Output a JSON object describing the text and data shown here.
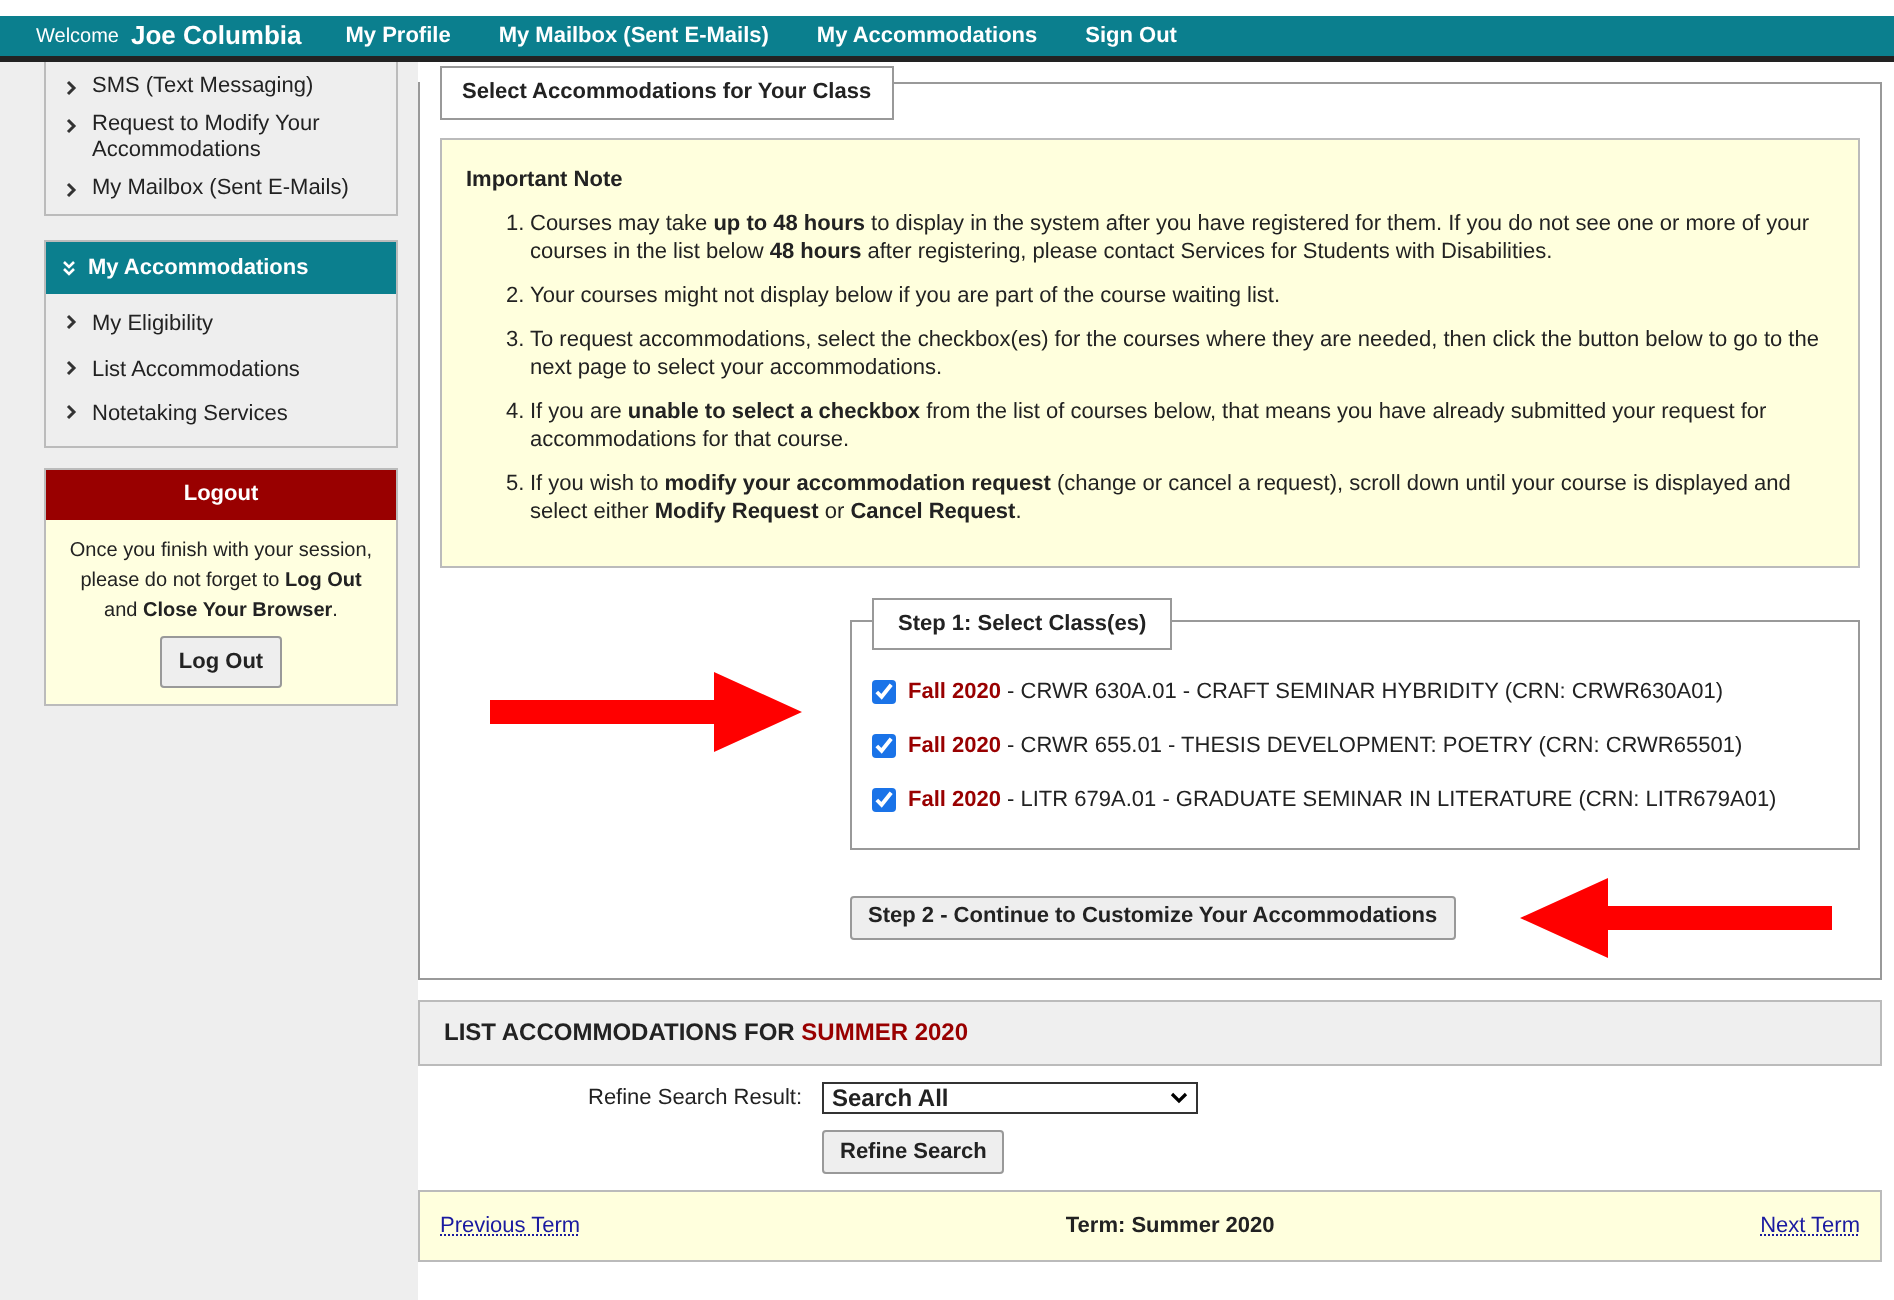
{
  "top_bar": {
    "welcome": "Welcome",
    "user": "Joe Columbia",
    "links": [
      "My Profile",
      "My Mailbox (Sent E-Mails)",
      "My Accommodations",
      "Sign Out"
    ]
  },
  "sidebar": {
    "top_items": [
      "SMS (Text Messaging)",
      "Request to Modify Your Accommodations",
      "My Mailbox (Sent E-Mails)"
    ],
    "section": {
      "title": "My Accommodations",
      "expanded": true,
      "items": [
        "My Eligibility",
        "List Accommodations",
        "Notetaking Services"
      ]
    },
    "logout": {
      "title": "Logout",
      "message": "Once you finish with your session, please do not forget to **Log Out** and **Close Your Browser**.",
      "button": "Log Out"
    }
  },
  "main": {
    "legend": "Select Accommodations for Your Class",
    "note_title": "Important Note",
    "notes": [
      {
        "number": "1.",
        "text": "Courses may take **up to 48 hours** to display in the system after you have registered for them. If you do not see one or more of your courses in the list below **48 hours** after registering, please contact Services for Students with Disabilities."
      },
      {
        "number": "2.",
        "text": "Your courses might not display below if you are part of the course waiting list."
      },
      {
        "number": "3.",
        "text": "To request accommodations, select the checkbox(es) for the courses where they are needed, then click the button below to go to the next page to select your accommodations."
      },
      {
        "number": "4.",
        "text": "If you are **unable to select a checkbox** from the list of courses below, that means you have already submitted your request for accommodations for that course."
      },
      {
        "number": "5.",
        "text": "If you wish to **modify your accommodation request** (change or cancel a request), scroll down until your course is displayed and select either **Modify Request** or **Cancel Request**."
      }
    ],
    "step1_legend": "Step 1: Select Class(es)",
    "courses": [
      {
        "term": "Fall 2020",
        "detail": " - CRWR 630A.01 - CRAFT SEMINAR HYBRIDITY (CRN: CRWR630A01)",
        "checked": true
      },
      {
        "term": "Fall 2020",
        "detail": " - CRWR 655.01 - THESIS DEVELOPMENT: POETRY (CRN: CRWR65501)",
        "checked": true
      },
      {
        "term": "Fall 2020",
        "detail": " - LITR 679A.01 - GRADUATE SEMINAR IN LITERATURE (CRN: LITR679A01)",
        "checked": true
      }
    ],
    "step2_button": "Step 2 - Continue to Customize Your Accommodations",
    "annotations": [
      {
        "kind": "right_arrow"
      },
      {
        "kind": "left_arrow"
      }
    ]
  },
  "list": {
    "heading": "LIST ACCOMMODATIONS FOR ",
    "term": "SUMMER 2020",
    "refine_label": "Refine Search Result:",
    "refine_value": "Search All",
    "refine_button": "Refine Search",
    "previous": "Previous Term",
    "current": "Term: Summer 2020",
    "next": "Next Term"
  }
}
